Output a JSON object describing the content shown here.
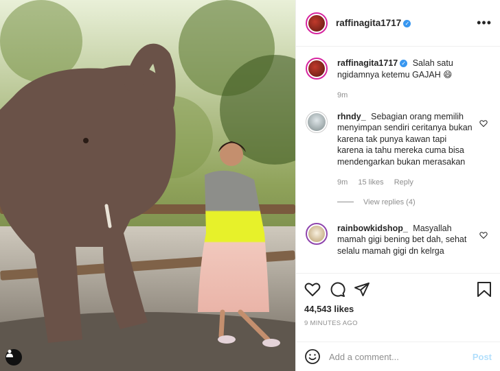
{
  "header": {
    "username": "raffinagita1717",
    "verified_icon": "verified-badge-icon",
    "more_icon": "more-options-icon"
  },
  "caption": {
    "username": "raffinagita1717",
    "text": "Salah satu ngidamnya ketemu GAJAH 😄",
    "time": "9m"
  },
  "comments": [
    {
      "username": "rhndy_",
      "text": "Sebagian orang memilih menyimpan sendiri ceritanya bukan karena tak punya kawan tapi karena ia tahu mereka cuma bisa mendengarkan bukan merasakan",
      "time": "9m",
      "likes": "15 likes",
      "reply": "Reply",
      "view_replies": "View replies (4)"
    },
    {
      "username": "rainbowkidshop_",
      "text": "Masyallah mamah gigi bening bet dah, sehat selalu mamah gigi dn kelrga"
    }
  ],
  "actions": {
    "likes": "44,543 likes",
    "time_ago": "9 MINUTES AGO"
  },
  "add_comment": {
    "placeholder": "Add a comment...",
    "post_label": "Post"
  },
  "colors": {
    "link_blue": "#3897f0",
    "post_disabled": "#b2dffc",
    "muted": "#8e8e8e"
  }
}
